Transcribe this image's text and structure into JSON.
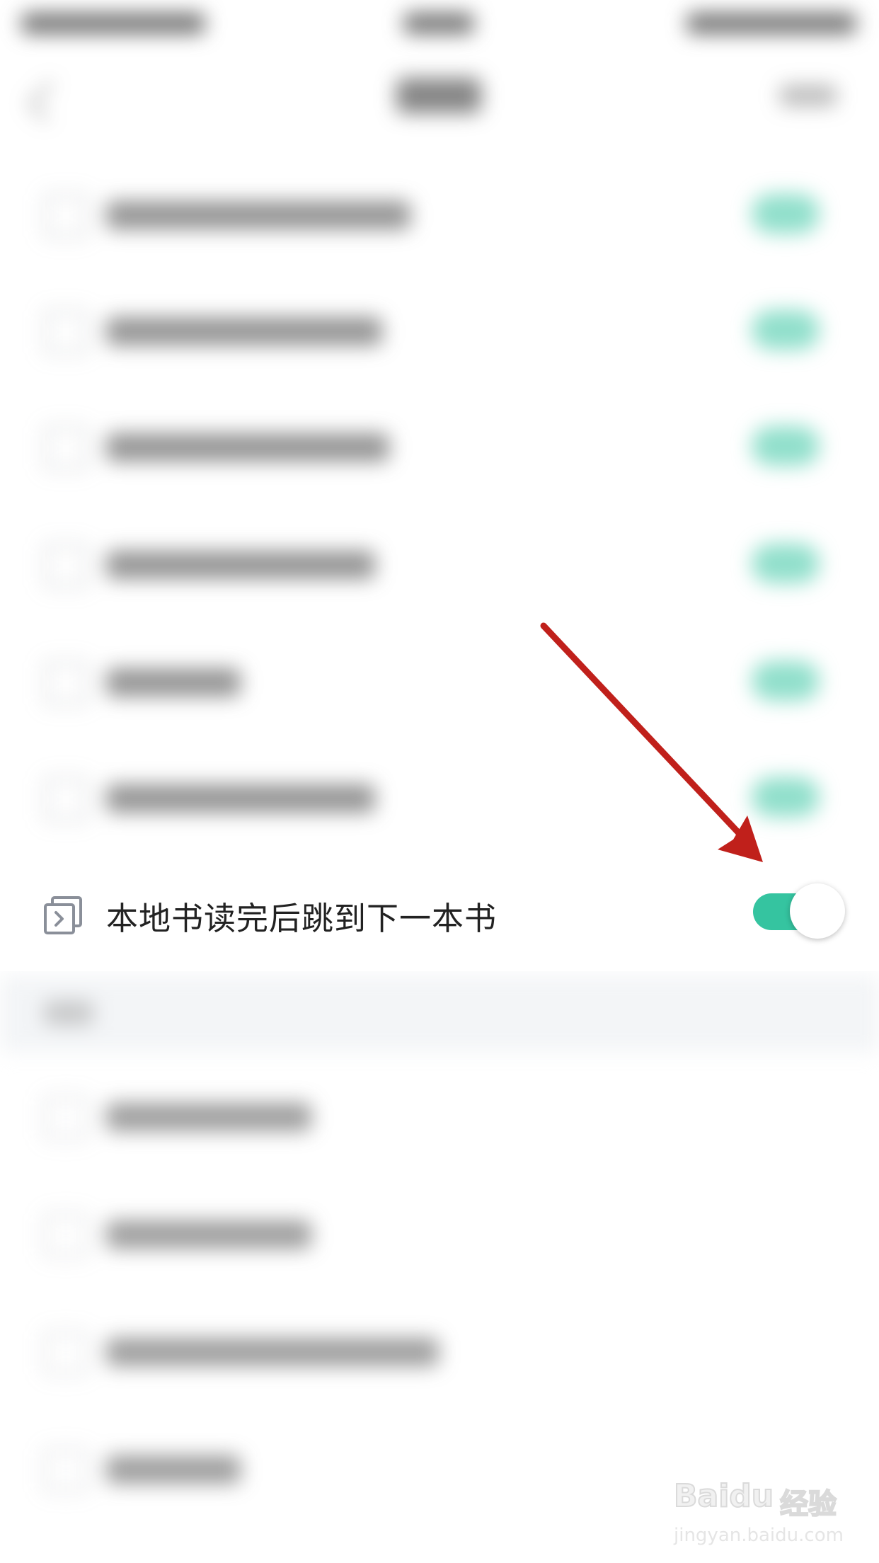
{
  "setting": {
    "label": "本地书读完后跳到下一本书",
    "toggle_on": true
  },
  "colors": {
    "accent": "#35c4a0",
    "arrow": "#c0201b",
    "section_band": "#f3f5f7"
  },
  "icons": {
    "setting_icon": "next-book-icon"
  },
  "watermark": {
    "brand": "Baidu",
    "brand_cn": "经验",
    "url": "jingyan.baidu.com"
  }
}
